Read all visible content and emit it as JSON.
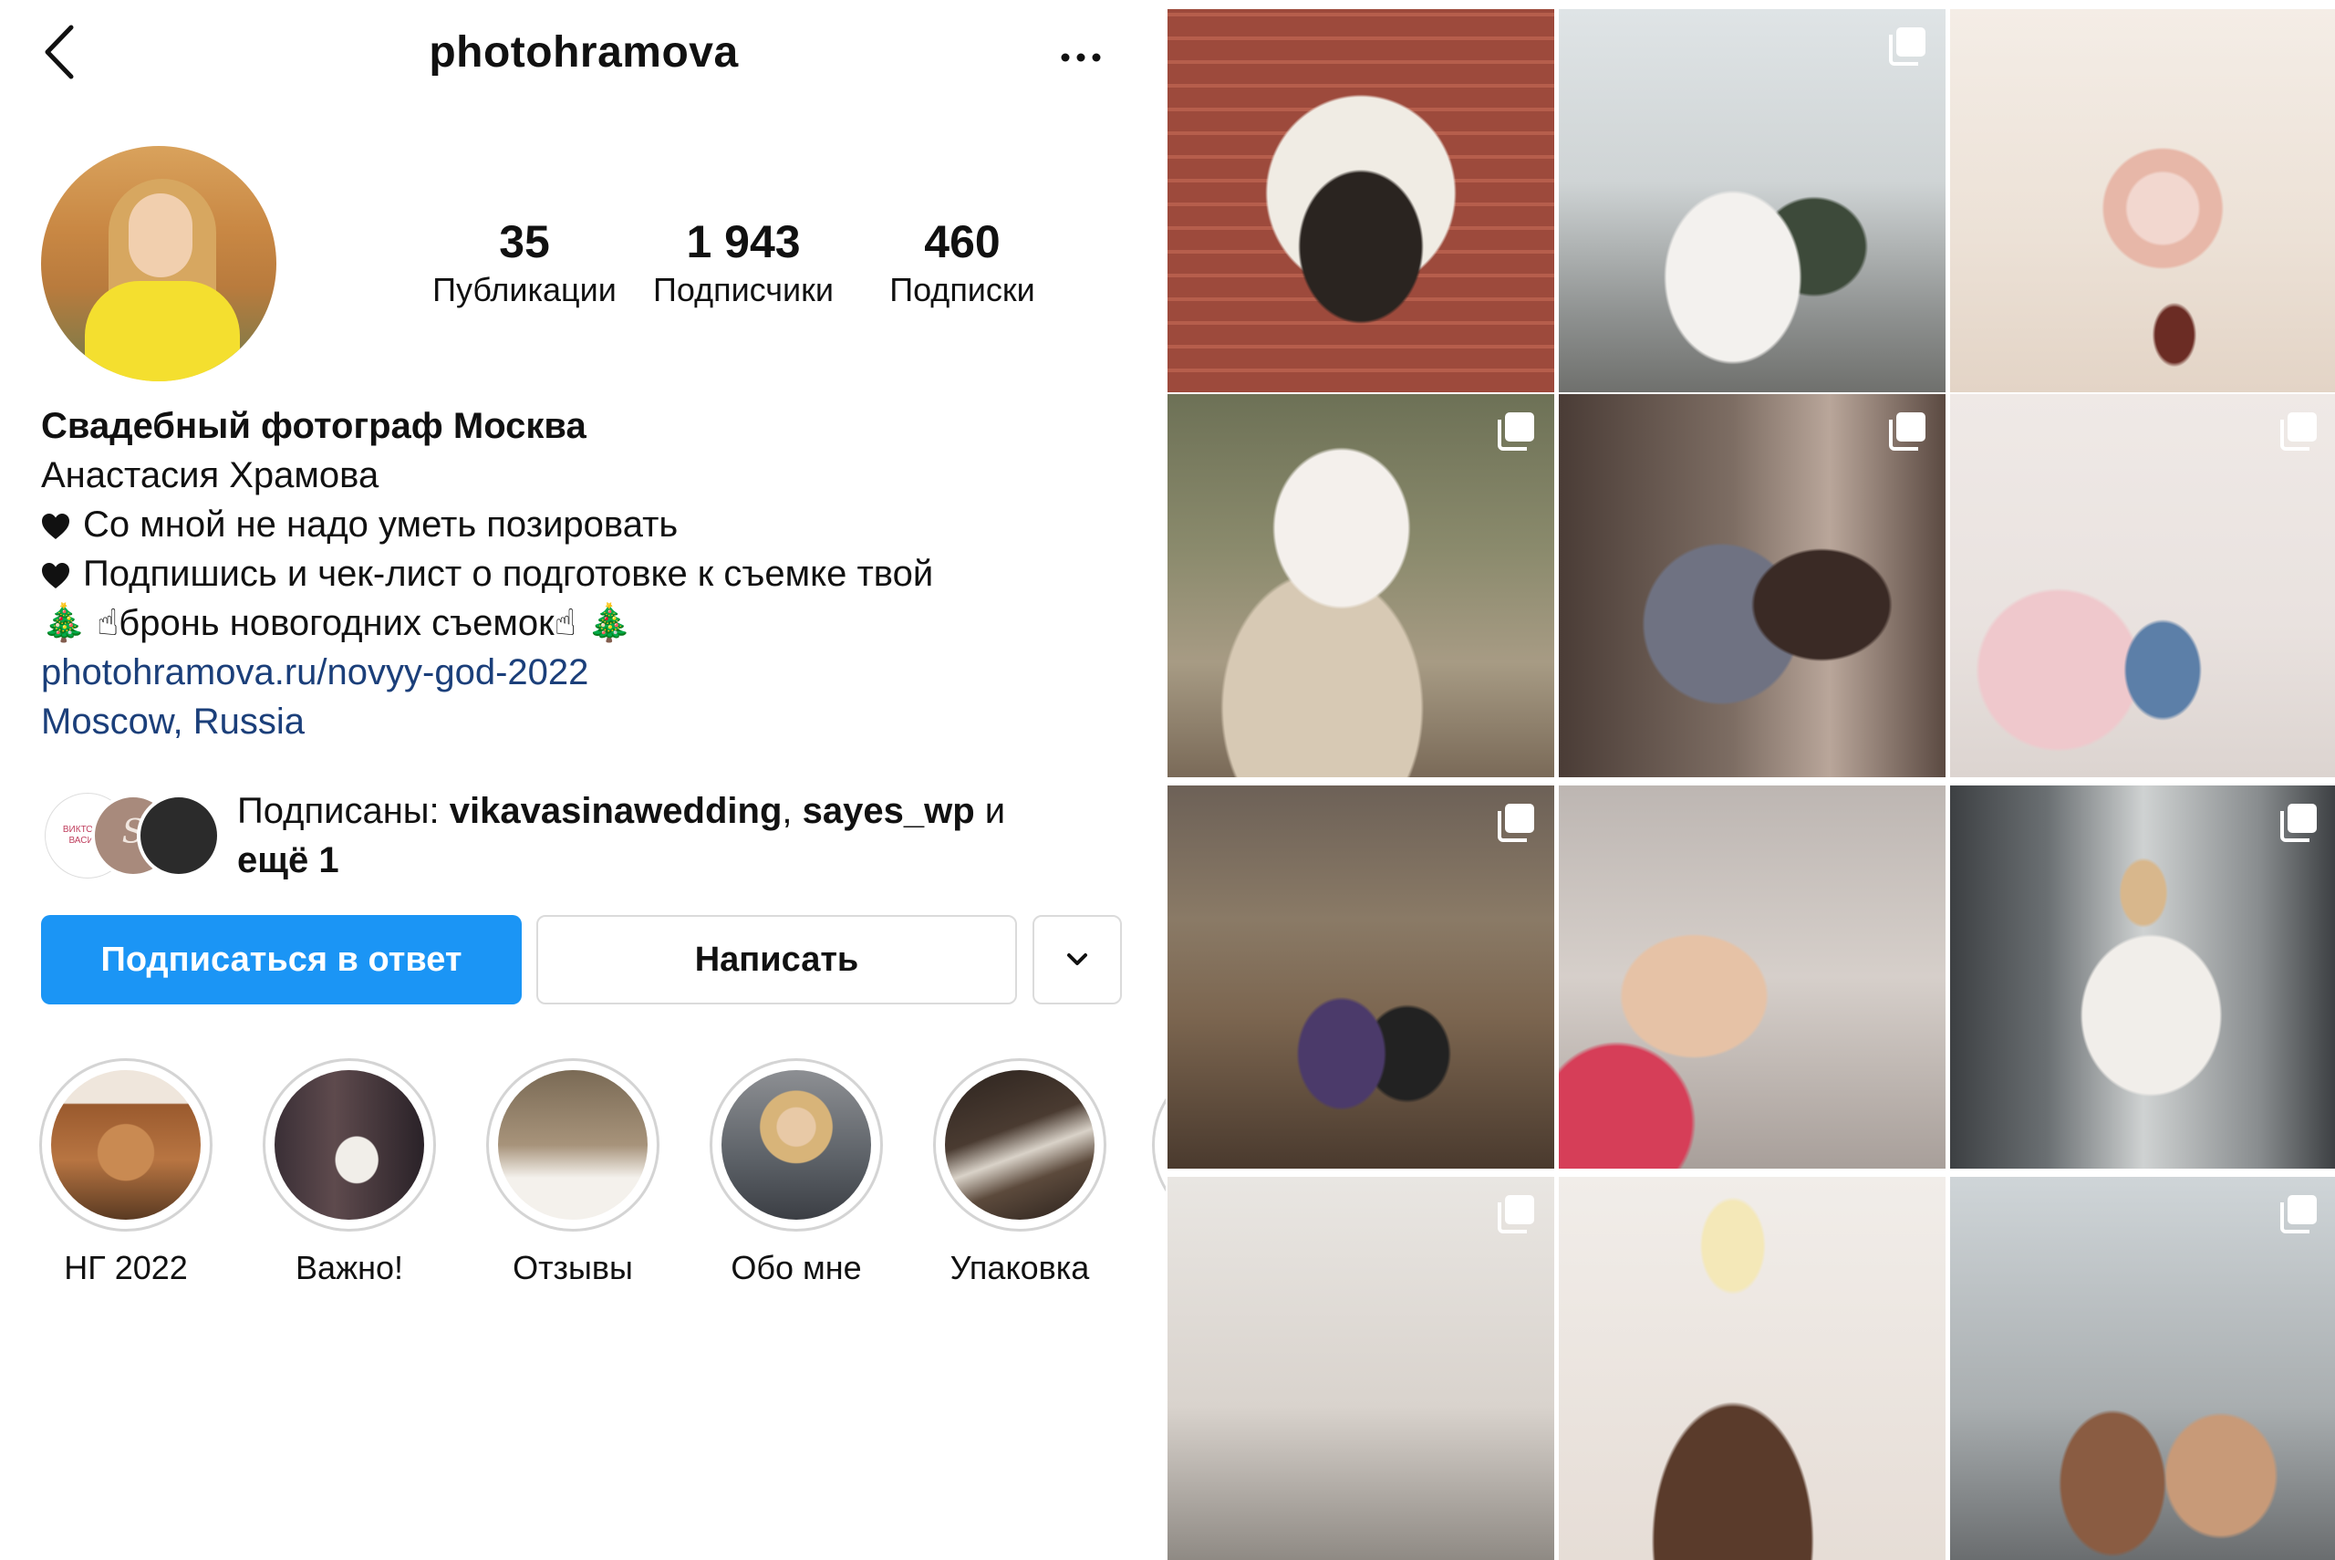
{
  "header": {
    "username": "photohramova",
    "back_icon": "chevron-left-icon",
    "more_icon": "more-horizontal-icon"
  },
  "stats": {
    "posts": {
      "value": "35",
      "label": "Публикации"
    },
    "followers": {
      "value": "1 943",
      "label": "Подписчики"
    },
    "following": {
      "value": "460",
      "label": "Подписки"
    }
  },
  "bio": {
    "name": "Свадебный фотограф Москва",
    "full_name": "Анастасия Храмова",
    "line1": "Со мной не надо уметь позировать",
    "line2": "Подпишись и чек-лист о подготовке к съемке твой",
    "line3_tree": "🎄",
    "line3_text": "бронь новогодних съемок",
    "link": "photohramova.ru/novyy-god-2022",
    "location": "Moscow, Russia"
  },
  "followed_by": {
    "prefix": "Подписаны: ",
    "user1": "vikavasinawedding",
    "sep": ", ",
    "user2": "sayes_wp",
    "suffix": " и",
    "more": "ещё 1",
    "fav1_text": "ВИКТОРИЯ ВАСИНА",
    "fav2_text": "S"
  },
  "actions": {
    "follow_back": "Подписаться в ответ",
    "message": "Написать",
    "dropdown_icon": "chevron-down-icon"
  },
  "highlights": [
    {
      "label": "НГ 2022"
    },
    {
      "label": "Важно!"
    },
    {
      "label": "Отзывы"
    },
    {
      "label": "Обо мне"
    },
    {
      "label": "Упаковка"
    }
  ],
  "colors": {
    "primary_button": "#1b95f5",
    "link": "#1b3f7a",
    "border": "#dbdbdb"
  }
}
